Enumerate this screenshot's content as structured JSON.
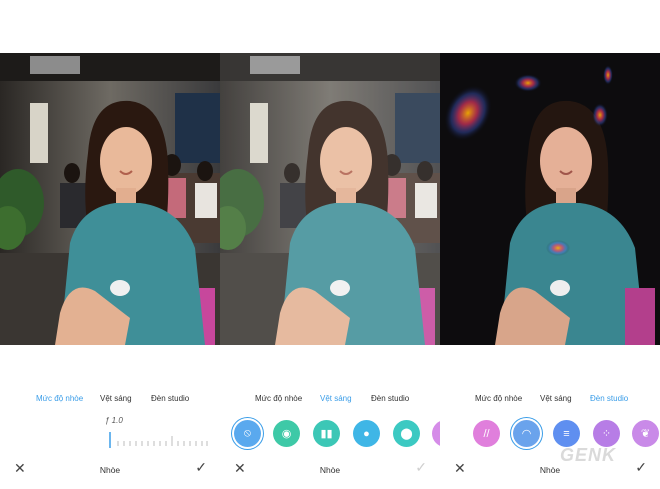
{
  "panels": [
    {
      "tabs": [
        "Mức độ nhòe",
        "Vệt sáng",
        "Đèn studio"
      ],
      "active_tab": 0,
      "aperture_value": "ƒ 1.0",
      "title": "Nhòe"
    },
    {
      "tabs": [
        "Mức độ nhòe",
        "Vệt sáng",
        "Đèn studio"
      ],
      "active_tab": 1,
      "title": "Nhòe",
      "effect_icons": [
        {
          "name": "none-effect-icon",
          "color": "#5aa9ee"
        },
        {
          "name": "circle-bokeh-icon",
          "color": "#3ec9a7"
        },
        {
          "name": "bars-effect-icon",
          "color": "#3cc7b6"
        },
        {
          "name": "dot-effect-icon",
          "color": "#3fb6e6"
        },
        {
          "name": "toggle-effect-icon",
          "color": "#3cc9c2"
        },
        {
          "name": "drop-effect-icon",
          "color": "#d58ce8"
        }
      ]
    },
    {
      "tabs": [
        "Mức độ nhòe",
        "Vệt sáng",
        "Đèn studio"
      ],
      "active_tab": 2,
      "title": "Nhòe",
      "effect_icons": [
        {
          "name": "slash-light-icon",
          "color": "#e07fdc"
        },
        {
          "name": "rainbow-light-icon",
          "color": "#6aa3ec"
        },
        {
          "name": "lines-light-icon",
          "color": "#5f8ff0"
        },
        {
          "name": "dots-light-icon",
          "color": "#b77de6"
        },
        {
          "name": "leaf-light-icon",
          "color": "#c98ae8"
        }
      ]
    }
  ],
  "watermark": "GENK",
  "colors": {
    "accent": "#3a9de8"
  }
}
